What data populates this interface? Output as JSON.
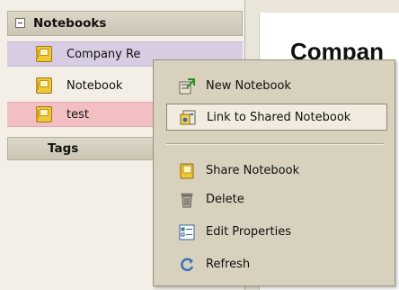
{
  "sidebar": {
    "notebooks_header": "Notebooks",
    "items": [
      {
        "label": "Company Re"
      },
      {
        "label": "Notebook"
      },
      {
        "label": "test"
      }
    ],
    "tags_header": "Tags"
  },
  "content": {
    "title": "Compan"
  },
  "context_menu": {
    "items": [
      {
        "label": "New Notebook",
        "icon": "new-notebook-icon"
      },
      {
        "label": "Link to Shared Notebook",
        "icon": "link-shared-notebook-icon"
      },
      {
        "label": "Share Notebook",
        "icon": "share-notebook-icon"
      },
      {
        "label": "Delete",
        "icon": "trash-icon"
      },
      {
        "label": "Edit Properties",
        "icon": "edit-properties-icon"
      },
      {
        "label": "Refresh",
        "icon": "refresh-icon"
      }
    ]
  },
  "colors": {
    "selected_item": "#d8cce3",
    "pink_item": "#f2c0c3",
    "menu_bg": "#d8d1bd"
  }
}
